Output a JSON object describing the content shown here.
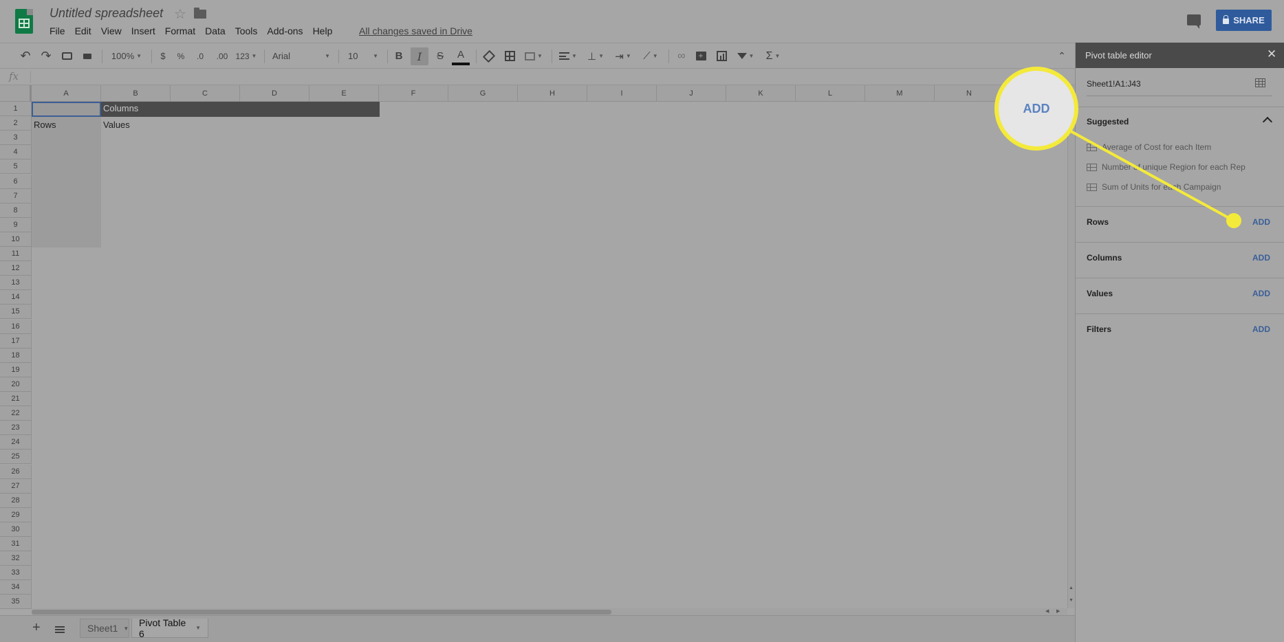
{
  "app": {
    "doc_title": "Untitled spreadsheet",
    "menu": [
      "File",
      "Edit",
      "View",
      "Insert",
      "Format",
      "Data",
      "Tools",
      "Add-ons",
      "Help"
    ],
    "save_status": "All changes saved in Drive",
    "share_label": "SHARE"
  },
  "toolbar": {
    "zoom": "100%",
    "currency": "$",
    "percent": "%",
    "decrease_decimal": ".0",
    "increase_decimal": ".00",
    "more_formats": "123",
    "font": "Arial",
    "font_size": "10",
    "bold": "B",
    "italic": "I",
    "strike": "S",
    "text_color": "A",
    "sum": "Σ"
  },
  "formula_bar": {
    "fx": "fx",
    "value": ""
  },
  "grid": {
    "columns": [
      "A",
      "B",
      "C",
      "D",
      "E",
      "F",
      "G",
      "H",
      "I",
      "J",
      "K",
      "L",
      "M",
      "N"
    ],
    "rows": [
      "1",
      "2",
      "3",
      "4",
      "5",
      "6",
      "7",
      "8",
      "9",
      "10",
      "11",
      "12",
      "13",
      "14",
      "15",
      "16",
      "17",
      "18",
      "19",
      "20",
      "21",
      "22",
      "23",
      "24",
      "25",
      "26",
      "27",
      "28",
      "29",
      "30",
      "31",
      "32",
      "33",
      "34",
      "35"
    ],
    "cells": {
      "B1": "Columns",
      "A2": "Rows",
      "B2": "Values"
    }
  },
  "sheets": {
    "tabs": [
      {
        "label": "Sheet1",
        "active": false
      },
      {
        "label": "Pivot Table 6",
        "active": true
      }
    ]
  },
  "panel": {
    "title": "Pivot table editor",
    "range": "Sheet1!A1:J43",
    "suggested_label": "Suggested",
    "suggestions": [
      "Average of Cost for each Item",
      "Number of unique Region for each Rep",
      "Sum of Units for each Campaign"
    ],
    "sections": [
      {
        "label": "Rows",
        "action": "ADD"
      },
      {
        "label": "Columns",
        "action": "ADD"
      },
      {
        "label": "Values",
        "action": "ADD"
      },
      {
        "label": "Filters",
        "action": "ADD"
      }
    ]
  },
  "callout": {
    "zoom_text": "ADD"
  },
  "colors": {
    "callout": "#f4ea3a",
    "link": "#3a5f98",
    "share": "#2f5b9c",
    "sheets_green": "#0f7a45"
  }
}
